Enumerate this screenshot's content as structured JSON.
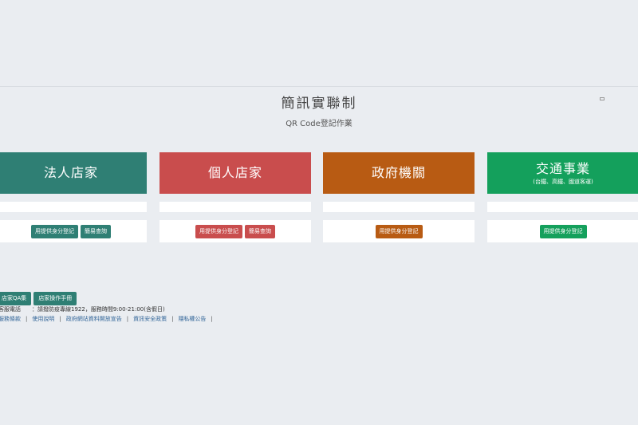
{
  "header": {
    "title": "簡訊實聯制",
    "subtitle": "QR Code登記作業"
  },
  "cards": [
    {
      "title": "法人店家",
      "subtitle": "",
      "buttons": [
        "用提供身分登記",
        "簡易查詢"
      ],
      "color": "#2f7f74"
    },
    {
      "title": "個人店家",
      "subtitle": "",
      "buttons": [
        "用提供身分登記",
        "簡易查詢"
      ],
      "color": "#c94d4d"
    },
    {
      "title": "政府機關",
      "subtitle": "",
      "buttons": [
        "用提供身分登記"
      ],
      "color": "#b85b13"
    },
    {
      "title": "交通事業",
      "subtitle": "(台鐵、高鐵、國道客運)",
      "buttons": [
        "用提供身分登記"
      ],
      "color": "#14a05c"
    }
  ],
  "footer": {
    "buttons": [
      "店家QA集",
      "店家操作手冊"
    ],
    "hotline_label": "客服電話",
    "hotline_value": "：請撥防疫專線1922，服務時間9:00-21:00(含假日)",
    "links": [
      "服務條款",
      "使用說明",
      "政府網站資料開放宣告",
      "資訊安全政策",
      "隱私權公告"
    ],
    "link_separator": "|"
  }
}
